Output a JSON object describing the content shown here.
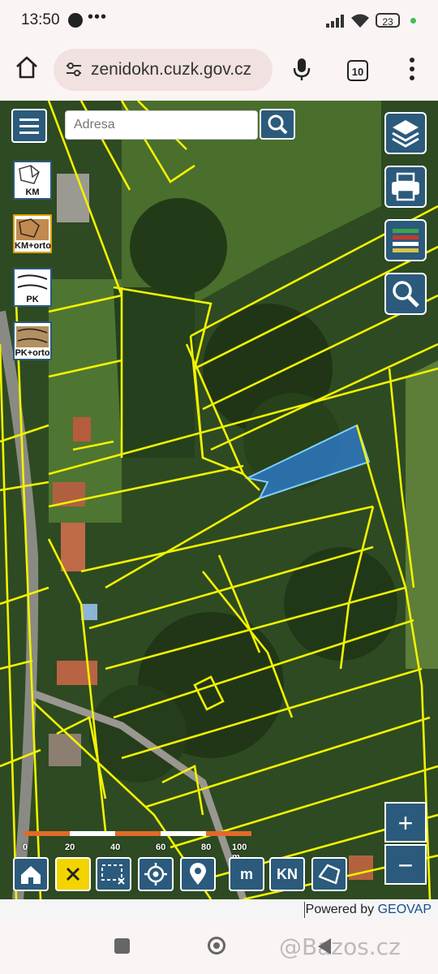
{
  "status_bar": {
    "time": "13:50",
    "dots": "•••",
    "battery": "23"
  },
  "browser": {
    "url": "zenidokn.cuzk.gov.cz",
    "tab_count": "10"
  },
  "map": {
    "search_placeholder": "Adresa",
    "layers": [
      {
        "label": "KM"
      },
      {
        "label": "KM+orto"
      },
      {
        "label": "PK"
      },
      {
        "label": "PK+orto"
      }
    ],
    "zoom_in": "+",
    "zoom_out": "−",
    "scale_ticks": [
      "0",
      "20",
      "40",
      "60",
      "80",
      "100 m"
    ],
    "toolbar": {
      "kn_label": "KN",
      "measure_label": "m"
    },
    "colors": {
      "parcel_lines": "#f2f200",
      "selected_parcel": "#2f7fd8",
      "control_blue": "#2b5a7c"
    }
  },
  "footer": {
    "powered_by": "Powered by",
    "brand": "GEOVAP"
  },
  "nav_bar": {
    "watermark": "@Bazos.cz"
  }
}
